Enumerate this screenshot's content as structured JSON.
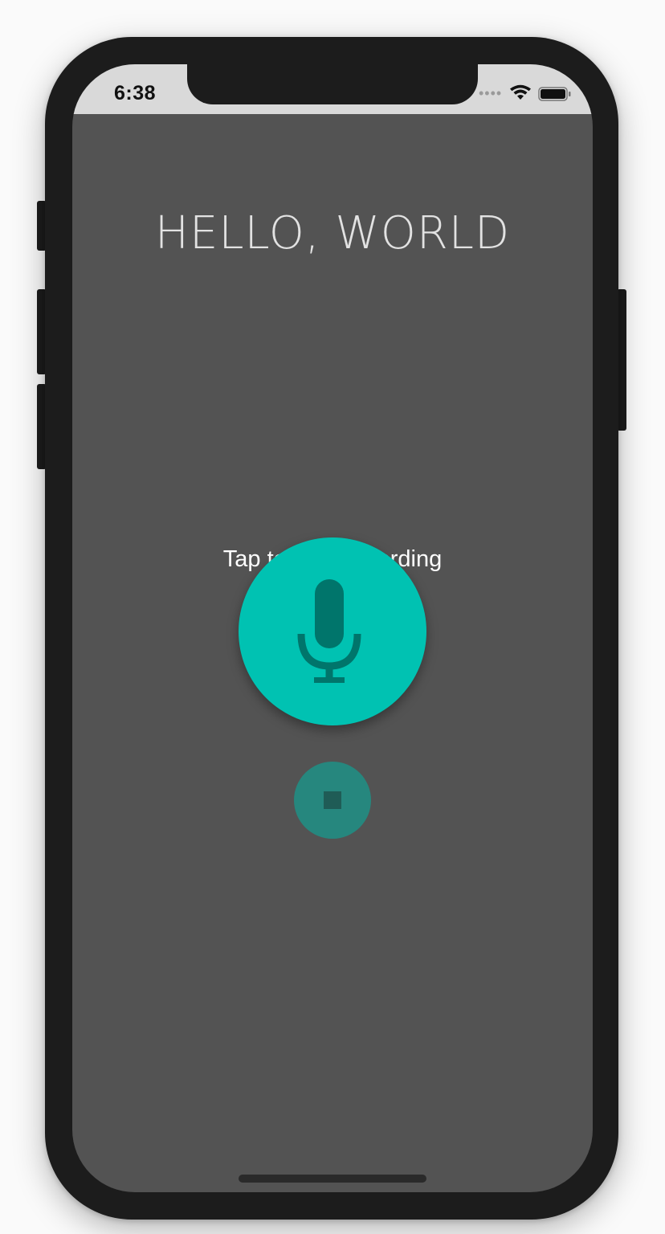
{
  "status_bar": {
    "time": "6:38",
    "signal_icon": "signal-dots-icon",
    "wifi_icon": "wifi-icon",
    "battery_icon": "battery-icon"
  },
  "main": {
    "title": "HELLO, WORLD",
    "hint": "Tap to start recording",
    "record_button": {
      "icon": "microphone-icon"
    },
    "stop_button": {
      "icon": "stop-icon"
    }
  },
  "colors": {
    "screen_background": "#535353",
    "accent": "#00c2b2",
    "accent_dark": "#00756b",
    "stop_button": "#26877e",
    "device_frame": "#1c1c1c"
  }
}
